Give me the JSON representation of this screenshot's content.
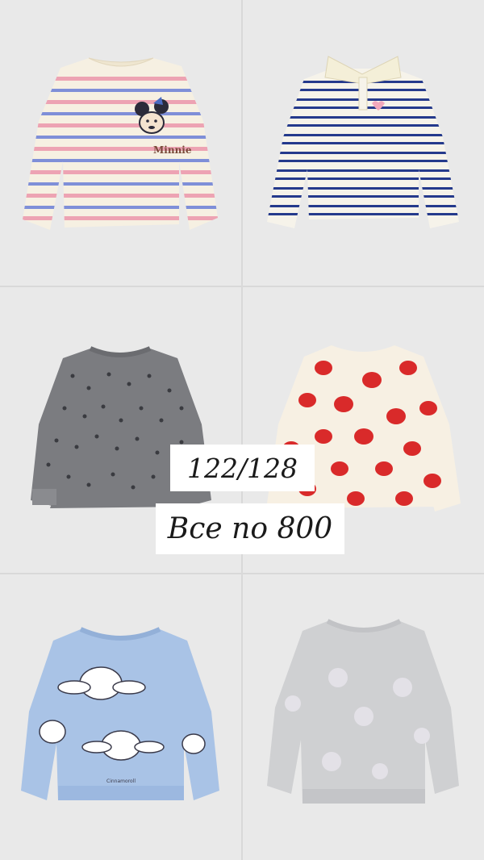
{
  "products": [
    {
      "name": "striped-sweatshirt-minnie",
      "print_text": "Minnie"
    },
    {
      "name": "striped-polo-shirt"
    },
    {
      "name": "grey-heart-peplum-sweatshirt"
    },
    {
      "name": "red-heart-peplum-sweatshirt"
    },
    {
      "name": "blue-cinnamoroll-sweatshirt",
      "print_text": "Cinnamoroll"
    },
    {
      "name": "grey-sequin-sweatshirt"
    }
  ],
  "overlay": {
    "size": "122/128",
    "price": "Все по 800"
  },
  "colors": {
    "background": "#e9e9e9",
    "label_bg": "#ffffff",
    "text": "#1a1a1a"
  }
}
